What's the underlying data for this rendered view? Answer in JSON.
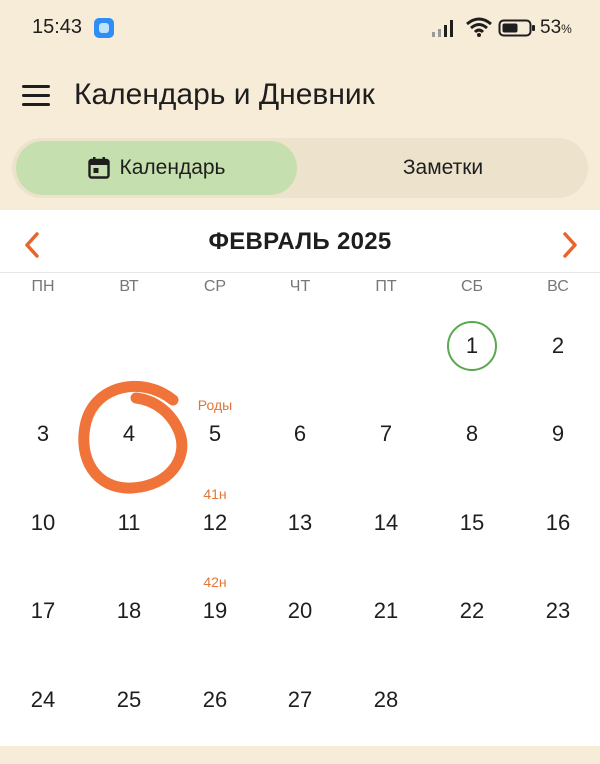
{
  "status_bar": {
    "time": "15:43",
    "battery_percent": "53",
    "battery_unit": "%"
  },
  "app_bar": {
    "title": "Календарь и Дневник"
  },
  "tabs": [
    {
      "label": "Календарь",
      "active": true,
      "icon": "calendar-icon"
    },
    {
      "label": "Заметки",
      "active": false
    }
  ],
  "calendar": {
    "month_title": "ФЕВРАЛЬ 2025",
    "weekdays": [
      "ПН",
      "ВТ",
      "СР",
      "ЧТ",
      "ПТ",
      "СБ",
      "ВС"
    ],
    "today": "1",
    "weeks": [
      [
        "",
        "",
        "",
        "",
        "",
        "1",
        "2"
      ],
      [
        "3",
        "4",
        "5",
        "6",
        "7",
        "8",
        "9"
      ],
      [
        "10",
        "11",
        "12",
        "13",
        "14",
        "15",
        "16"
      ],
      [
        "17",
        "18",
        "19",
        "20",
        "21",
        "22",
        "23"
      ],
      [
        "24",
        "25",
        "26",
        "27",
        "28",
        "",
        ""
      ]
    ],
    "notes": [
      {
        "day": "5",
        "text": "Роды"
      },
      {
        "day": "12",
        "text": "41н"
      },
      {
        "day": "19",
        "text": "42н"
      }
    ]
  },
  "colors": {
    "background": "#f7ecd8",
    "active_tab": "#c5e0ae",
    "accent_orange": "#e8652c",
    "note_orange": "#e0763a",
    "today_ring": "#5aa84f"
  }
}
